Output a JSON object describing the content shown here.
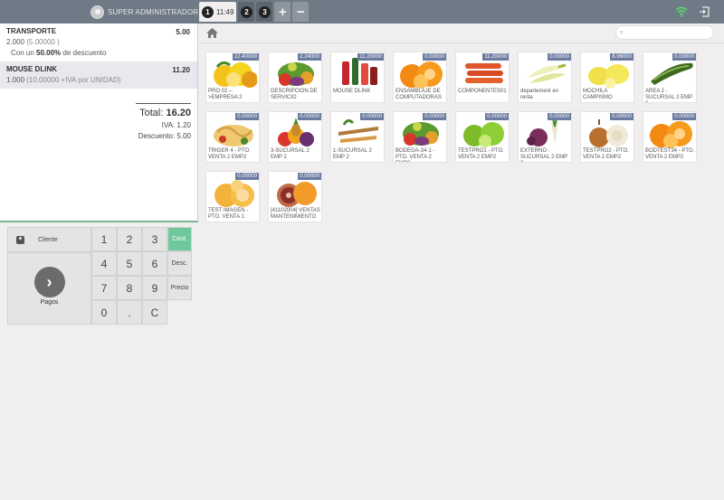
{
  "header": {
    "user_name": "SUPER ADMINISTRADOR",
    "active_order_number": "1",
    "active_order_time": "11:49",
    "orders": [
      "2",
      "3"
    ],
    "add_label": "+",
    "remove_label": "−"
  },
  "orderlines": [
    {
      "name": "TRANSPORTE",
      "price": "5.00",
      "qty": "2.000",
      "unit_price": "(5.00000 )",
      "discount_prefix": "Con un",
      "discount_value": "50.00%",
      "discount_suffix": "de descuento"
    },
    {
      "name": "MOUSE DLINK",
      "price": "11.20",
      "qty": "1.000",
      "unit_price": "(10.00000 +IVA por UNIDAD)"
    }
  ],
  "summary": {
    "total_label": "Total:",
    "total_value": "16.20",
    "tax": "IVA: 1.20",
    "discount": "Descuento: 5.00"
  },
  "actions": {
    "customer_label": "Cliente",
    "payment_label": "Pagos"
  },
  "numpad": {
    "keys": [
      "1",
      "2",
      "3",
      "4",
      "5",
      "6",
      "7",
      "8",
      "9",
      "0",
      ".",
      "C"
    ],
    "modes": [
      "Cant.",
      "Desc.",
      "Precio"
    ],
    "active_mode": "Cant."
  },
  "search": {
    "value": ""
  },
  "products": [
    {
      "name": "PRO 02 -->EMPRESA 2",
      "price": "22.40000",
      "art": "citrus"
    },
    {
      "name": "DESCRIPCION DE SERVICIO",
      "price": "2.24000",
      "art": "veggies"
    },
    {
      "name": "MOUSE DLINK",
      "price": "11.20000",
      "art": "drinks"
    },
    {
      "name": "ENSAMBLAJE DE COMPUTADORAS",
      "price": "0.00000",
      "art": "oranges"
    },
    {
      "name": "COMPONENTES01",
      "price": "11.20000",
      "art": "carrots"
    },
    {
      "name": "departement en renta",
      "price": "0.00000",
      "art": "endive"
    },
    {
      "name": "MOCHILA CAMPISMO",
      "price": "8.96000",
      "art": "lemons"
    },
    {
      "name": "AREA 2 - SUCURSAL 2 EMP 2",
      "price": "0.00000",
      "art": "zucchini"
    },
    {
      "name": "TRIGER 4 - PTO. VENTA 2 EMP2",
      "price": "0.00000",
      "art": "pasta"
    },
    {
      "name": "3-SUCURSAL 2 EMP 2",
      "price": "0.00000",
      "art": "fruitmix"
    },
    {
      "name": "1-SUCURSAL 2 EMP 2",
      "price": "0.00000",
      "art": "roots"
    },
    {
      "name": "BODEGA-34-1 - PTO. VENTA 2 EMP2",
      "price": "0.00000",
      "art": "veggies"
    },
    {
      "name": "TESTPRO1 - PTO. VENTA 2 EMP2",
      "price": "0.00000",
      "art": "limes"
    },
    {
      "name": "EXTERNO - SUCURSAL 2 EMP 2",
      "price": "0.00000",
      "art": "onions"
    },
    {
      "name": "TESTPRO2 - PTO. VENTA 2 EMP2",
      "price": "0.00000",
      "art": "brownonions"
    },
    {
      "name": "BODTEST34 - PTO. VENTA 2 EMP2",
      "price": "0.00000",
      "art": "oranges"
    },
    {
      "name": "TEST IMAGEN - PTO. VENTA 1",
      "price": "0.00000",
      "art": "grapefruit"
    },
    {
      "name": "[41102004] VENTAS MANTENIMIENTO",
      "price": "0.00000",
      "art": "blood"
    }
  ],
  "colors": {
    "topbar": "#6e7a85",
    "accent_green": "#6ec89b",
    "price_tag": "#6c7ba0",
    "divider_green": "#76b98d"
  }
}
